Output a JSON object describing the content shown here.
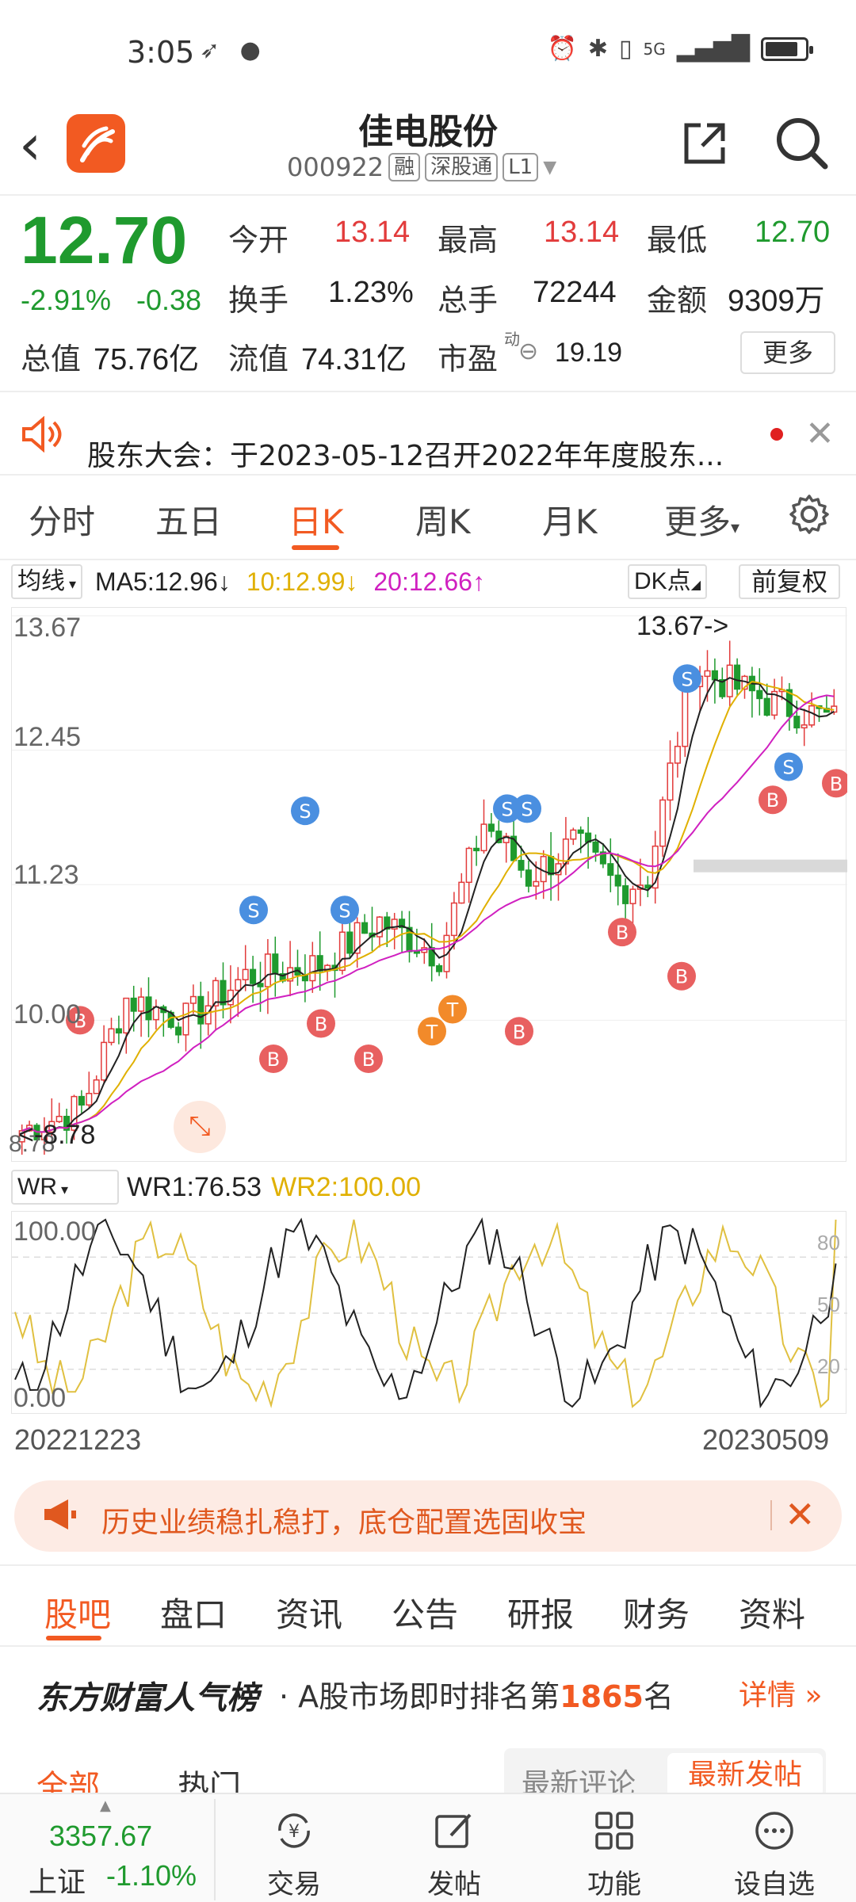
{
  "status": {
    "time": "3:05",
    "network": "5G"
  },
  "header": {
    "stock_name": "佳电股份",
    "stock_code": "000922",
    "tags": [
      "融",
      "深股通",
      "L1"
    ]
  },
  "quote": {
    "price": "12.70",
    "change_pct": "-2.91%",
    "change": "-0.38",
    "fields": {
      "open_label": "今开",
      "open": "13.14",
      "high_label": "最高",
      "high": "13.14",
      "low_label": "最低",
      "low": "12.70",
      "turnover_label": "换手",
      "turnover": "1.23%",
      "volume_label": "总手",
      "volume": "72244",
      "amount_label": "金额",
      "amount": "9309万",
      "mktcap_label": "总值",
      "mktcap": "75.76亿",
      "float_label": "流值",
      "float": "74.31亿",
      "pe_label": "市盈",
      "pe_sup": "动",
      "pe": "19.19"
    },
    "more_label": "更多"
  },
  "notice": {
    "text": "股东大会：于2023-05-12召开2022年年度股东..."
  },
  "period_tabs": [
    "分时",
    "五日",
    "日K",
    "周K",
    "月K",
    "更多"
  ],
  "active_period": "日K",
  "ma": {
    "select_label": "均线",
    "ma5": "MA5:12.96↓",
    "ma10": "10:12.99↓",
    "ma20": "20:12.66↑",
    "dk_label": "DK点",
    "fuquan_label": "前复权"
  },
  "kchart": {
    "y_labels": [
      "13.67",
      "12.45",
      "11.23",
      "10.00",
      "8.78"
    ],
    "high_annot": "13.67->",
    "low_annot": "<-8.78"
  },
  "wr": {
    "select_label": "WR",
    "wr1": "WR1:76.53",
    "wr2": "WR2:100.00",
    "y_top": "100.00",
    "y_bottom": "0.00",
    "levels": [
      "80",
      "50",
      "20"
    ]
  },
  "chart_data": [
    {
      "type": "candlestick",
      "title": "日K",
      "x_start": "20221223",
      "x_end": "20230509",
      "ylim": [
        8.78,
        13.67
      ],
      "last": {
        "open": 13.14,
        "high": 13.14,
        "low": 12.7,
        "close": 12.7
      },
      "series": [
        {
          "name": "MA5",
          "last": 12.96
        },
        {
          "name": "MA10",
          "last": 12.99
        },
        {
          "name": "MA20",
          "last": 12.66
        }
      ]
    },
    {
      "type": "line",
      "title": "WR",
      "ylim": [
        0,
        100
      ],
      "series": [
        {
          "name": "WR1",
          "last": 76.53
        },
        {
          "name": "WR2",
          "last": 100.0
        }
      ]
    }
  ],
  "dates": {
    "start": "20221223",
    "end": "20230509"
  },
  "banner": {
    "text": "历史业绩稳扎稳打，底仓配置选固收宝"
  },
  "content_tabs": [
    "股吧",
    "盘口",
    "资讯",
    "公告",
    "研报",
    "财务",
    "资料"
  ],
  "rank": {
    "title": "东方财富人气榜",
    "prefix": "· A股市场即时排名第",
    "number": "1865",
    "suffix": "名",
    "detail": "详情"
  },
  "sub_tabs": {
    "all": "全部",
    "hot": "热门",
    "latest_comment": "最新评论",
    "latest_post": "最新发帖"
  },
  "bottom": {
    "index_value": "3357.67",
    "index_name": "上证",
    "index_change": "-1.10%",
    "nav": [
      "交易",
      "发帖",
      "功能",
      "设自选"
    ]
  },
  "colors": {
    "accent": "#f25a22",
    "up": "#e23b3b",
    "down": "#1f9a2e"
  }
}
